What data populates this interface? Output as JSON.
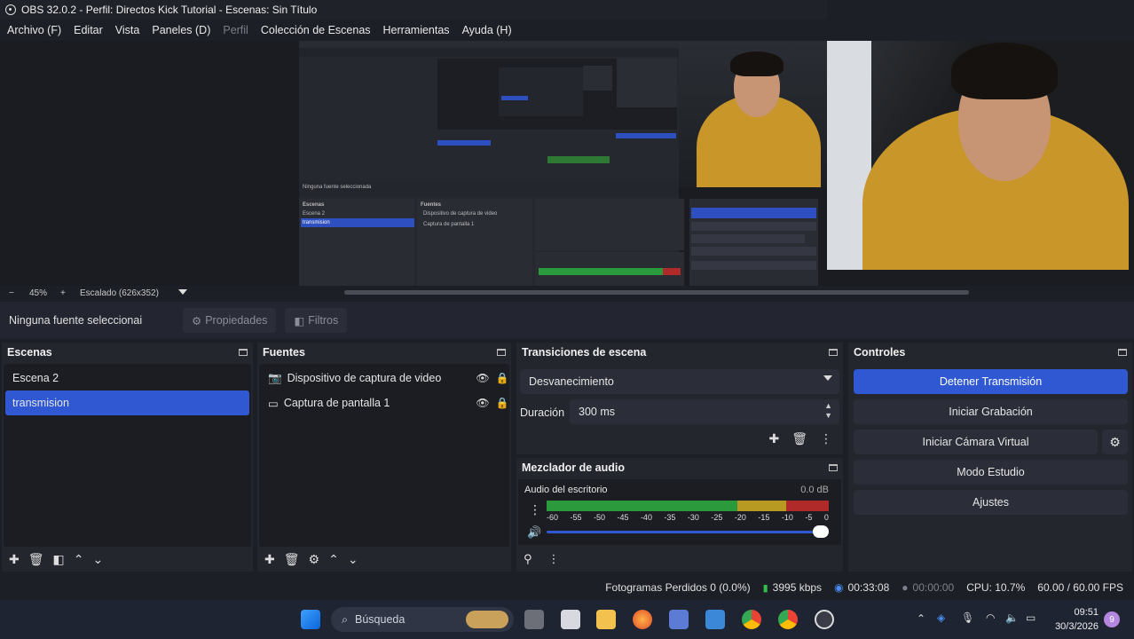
{
  "window": {
    "title": "OBS 32.0.2 - Perfil: Directos Kick Tutorial - Escenas: Sin Título"
  },
  "menu": [
    {
      "label": "Archivo (F)",
      "disabled": false
    },
    {
      "label": "Editar",
      "disabled": false
    },
    {
      "label": "Vista",
      "disabled": false
    },
    {
      "label": "Paneles (D)",
      "disabled": false
    },
    {
      "label": "Perfil",
      "disabled": true
    },
    {
      "label": "Colección de Escenas",
      "disabled": false
    },
    {
      "label": "Herramientas",
      "disabled": false
    },
    {
      "label": "Ayuda (H)",
      "disabled": false
    }
  ],
  "preview": {
    "zoom_minus": "−",
    "zoom": "45%",
    "zoom_plus": "+",
    "scaling": "Escalado (626x352)"
  },
  "source_toolbar": {
    "no_source": "Ninguna fuente seleccionai",
    "properties": "Propiedades",
    "filters": "Filtros"
  },
  "scenes": {
    "title": "Escenas",
    "items": [
      {
        "label": "Escena 2",
        "selected": false
      },
      {
        "label": "transmision",
        "selected": true
      }
    ]
  },
  "sources": {
    "title": "Fuentes",
    "items": [
      {
        "label": "Dispositivo de captura de video",
        "icon": "camera-icon"
      },
      {
        "label": "Captura de pantalla 1",
        "icon": "monitor-icon"
      }
    ]
  },
  "transitions": {
    "title": "Transiciones de escena",
    "transition": "Desvanecimiento",
    "duration_label": "Duración",
    "duration_value": "300 ms"
  },
  "mixer": {
    "title": "Mezclador de audio",
    "channel": "Audio del escritorio",
    "level": "0.0 dB",
    "ticks": [
      "-60",
      "-55",
      "-50",
      "-45",
      "-40",
      "-35",
      "-30",
      "-25",
      "-20",
      "-15",
      "-10",
      "-5",
      "0"
    ],
    "volume_percent": 100
  },
  "controls": {
    "title": "Controles",
    "buttons": [
      {
        "label": "Detener Transmisión",
        "active": true
      },
      {
        "label": "Iniciar Grabación",
        "active": false
      },
      {
        "label": "Iniciar Cámara Virtual",
        "active": false
      },
      {
        "label": "Modo Estudio",
        "active": false
      },
      {
        "label": "Ajustes",
        "active": false
      }
    ]
  },
  "status": {
    "dropped": "Fotogramas Perdidos 0 (0.0%)",
    "bitrate": "3995 kbps",
    "stream_time": "00:33:08",
    "record_time": "00:00:00",
    "cpu": "CPU: 10.7%",
    "fps": "60.00 / 60.00 FPS"
  },
  "taskbar": {
    "search": "Búsqueda",
    "time": "09:51",
    "date": "30/3/2026",
    "notifications": "9"
  },
  "colors": {
    "accent": "#2f58d2",
    "panel": "#24262e",
    "meter_green": "#2a9a3c",
    "meter_yellow": "#b89a22",
    "meter_red": "#b02a2a"
  }
}
